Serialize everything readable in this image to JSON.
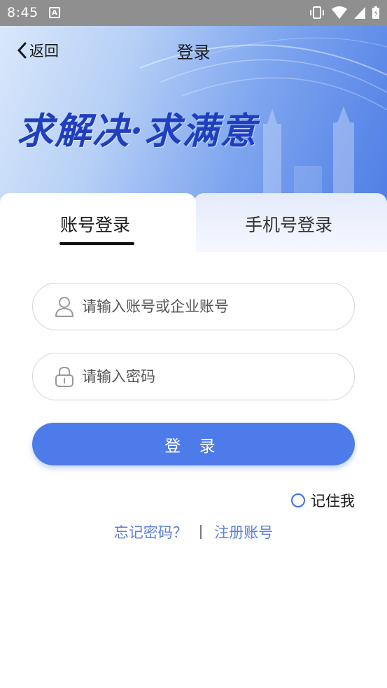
{
  "status_bar": {
    "time": "8:45",
    "notification_icon": "A"
  },
  "header": {
    "back_label": "返回",
    "title": "登录",
    "slogan": "求解决·求满意"
  },
  "tabs": [
    {
      "label": "账号登录",
      "active": true
    },
    {
      "label": "手机号登录",
      "active": false
    }
  ],
  "form": {
    "username_placeholder": "请输入账号或企业账号",
    "password_placeholder": "请输入密码",
    "login_label": "登 录",
    "remember_label": "记住我"
  },
  "links": {
    "forgot": "忘记密码？",
    "register": "注册账号"
  },
  "colors": {
    "accent": "#4d7cea",
    "link": "#5b7fd8",
    "banner_dark": "#4f7ee6"
  }
}
